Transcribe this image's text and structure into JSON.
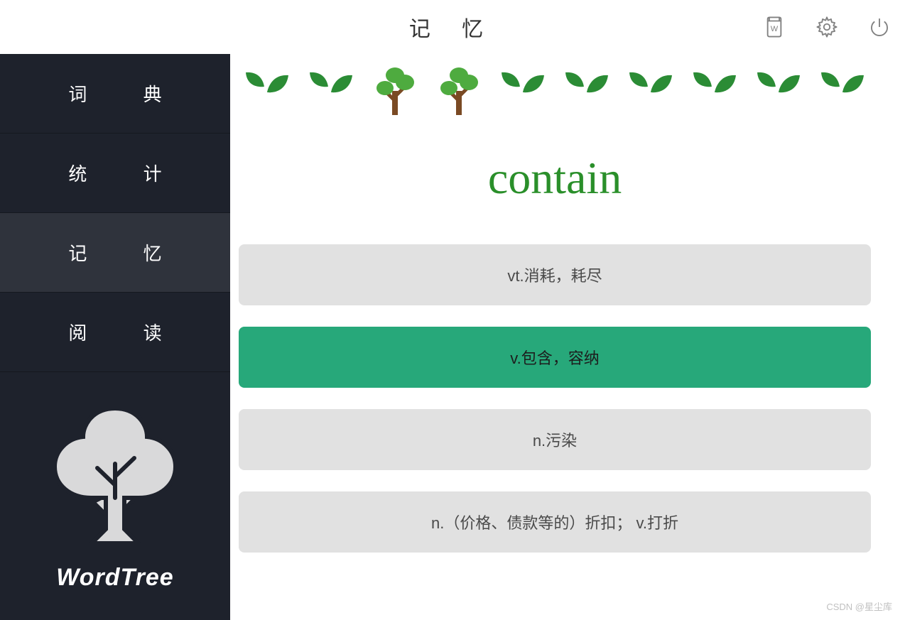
{
  "header": {
    "title": "记 忆"
  },
  "sidebar": {
    "items": [
      {
        "label": "词 典",
        "active": false
      },
      {
        "label": "统 计",
        "active": false
      },
      {
        "label": "记 忆",
        "active": true
      },
      {
        "label": "阅 读",
        "active": false
      }
    ],
    "brand": "WordTree"
  },
  "progress": {
    "slots": [
      "sprout",
      "sprout",
      "tree",
      "tree",
      "sprout",
      "sprout",
      "sprout",
      "sprout",
      "sprout",
      "sprout"
    ]
  },
  "quiz": {
    "word": "contain",
    "answers": [
      {
        "text": "vt.消耗，耗尽",
        "selected": false
      },
      {
        "text": "v.包含，容纳",
        "selected": true
      },
      {
        "text": "n.污染",
        "selected": false
      },
      {
        "text": "n.（价格、债款等的）折扣；   v.打折",
        "selected": false
      }
    ]
  },
  "watermark": "CSDN @星尘库"
}
